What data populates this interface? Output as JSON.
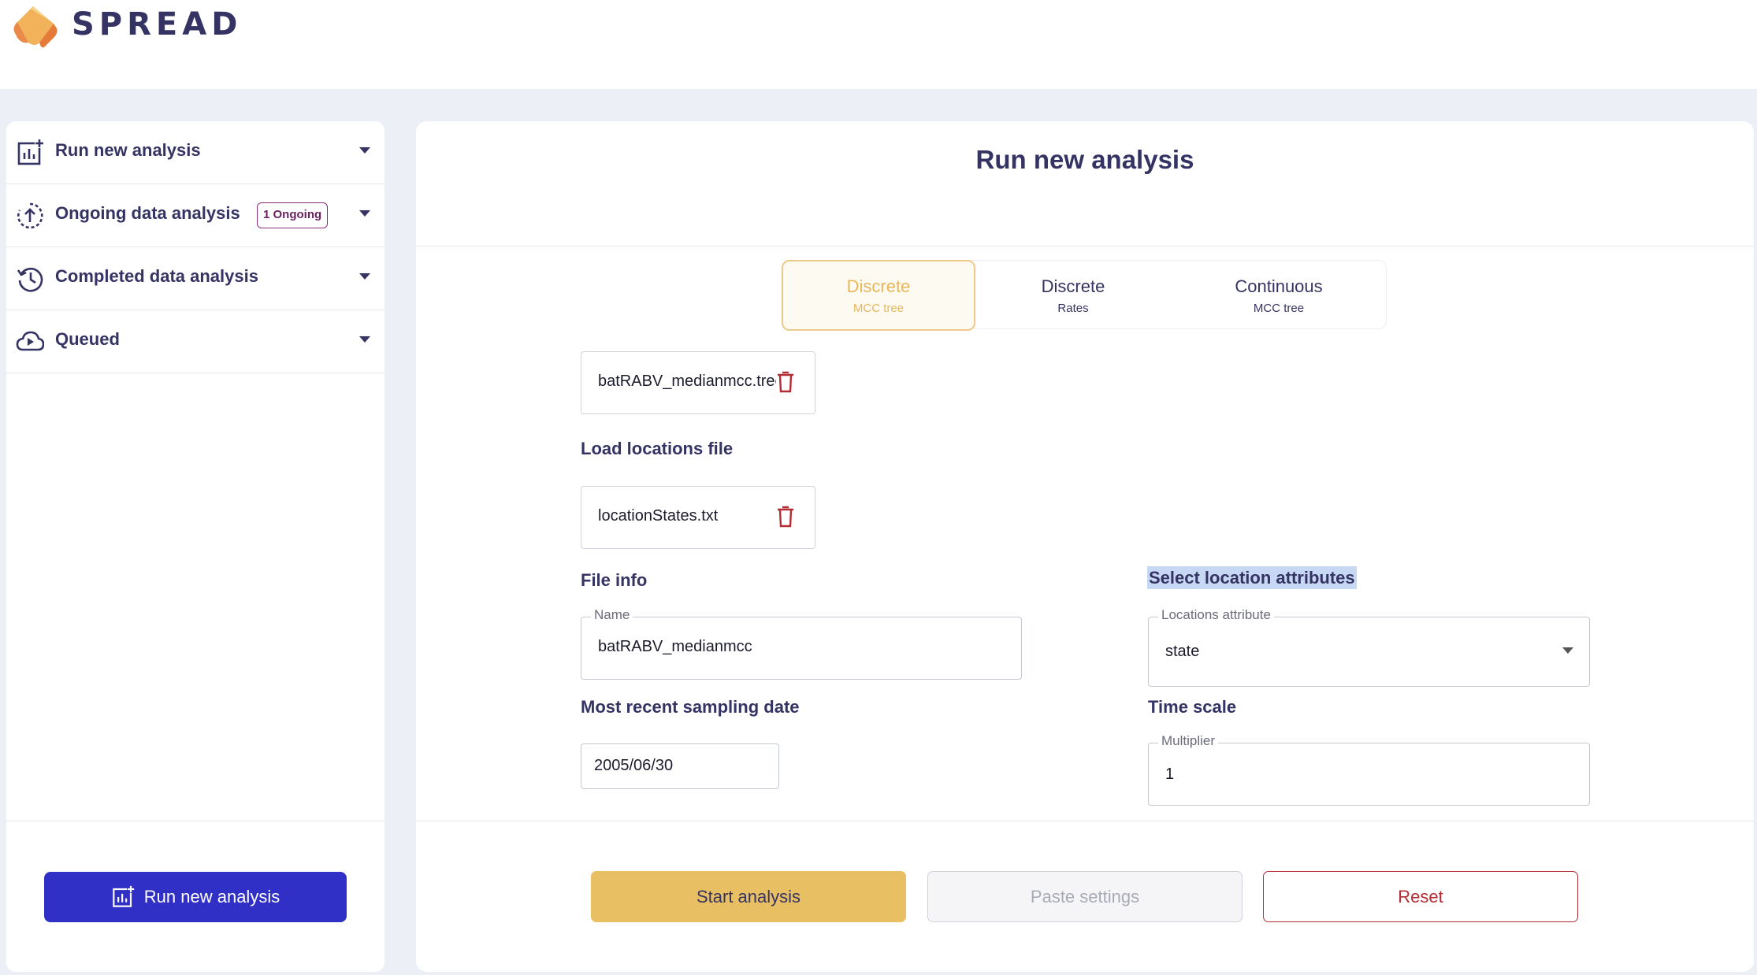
{
  "app": {
    "brand": "SPREAD",
    "brand_colors": {
      "orange": "#e8843a",
      "yellow": "#f1c35b",
      "navy": "#353363"
    }
  },
  "sidebar": {
    "items": [
      {
        "label": "Run new analysis",
        "icon": "chart-add-icon"
      },
      {
        "label": "Ongoing data analysis",
        "icon": "upload-progress-icon",
        "badge": "1 Ongoing"
      },
      {
        "label": "Completed data analysis",
        "icon": "history-icon"
      },
      {
        "label": "Queued",
        "icon": "cloud-queue-icon"
      }
    ],
    "run_button_label": "Run new analysis"
  },
  "main": {
    "title": "Run new analysis",
    "tabs": [
      {
        "title": "Discrete",
        "subtitle": "MCC tree",
        "active": true
      },
      {
        "title": "Discrete",
        "subtitle": "Rates",
        "active": false
      },
      {
        "title": "Continuous",
        "subtitle": "MCC tree",
        "active": false
      }
    ],
    "tree_file": "batRABV_medianmcc.tree",
    "load_locations_label": "Load locations file",
    "locations_file": "locationStates.txt",
    "file_info_label": "File info",
    "name_field": {
      "label": "Name",
      "value": "batRABV_medianmcc"
    },
    "sampling_date_label": "Most recent sampling date",
    "sampling_date_value": "2005/06/30",
    "select_locations_label": "Select location attributes",
    "locations_attribute": {
      "label": "Locations attribute",
      "value": "state"
    },
    "time_scale_label": "Time scale",
    "multiplier": {
      "label": "Multiplier",
      "value": "1"
    }
  },
  "actions": {
    "start": "Start analysis",
    "paste": "Paste settings",
    "reset": "Reset"
  }
}
